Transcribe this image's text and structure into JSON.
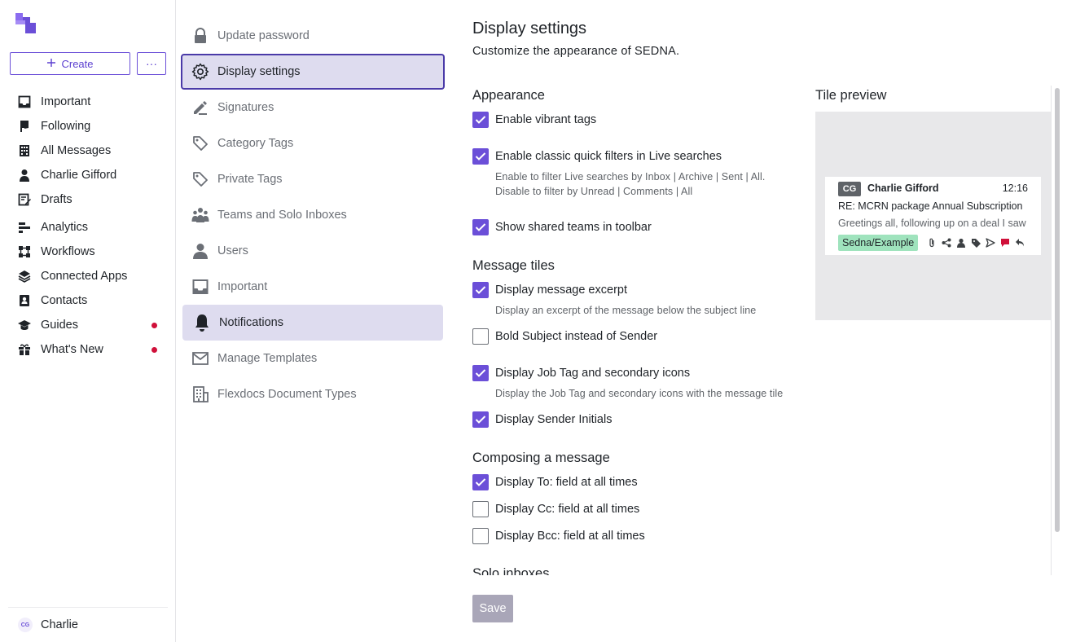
{
  "leftnav": {
    "create_label": "Create",
    "more_label": "···",
    "items": [
      {
        "label": "Important",
        "icon": "inbox-icon"
      },
      {
        "label": "Following",
        "icon": "flag-icon"
      },
      {
        "label": "All Messages",
        "icon": "building-icon"
      },
      {
        "label": "Charlie Gifford",
        "icon": "person-icon"
      },
      {
        "label": "Drafts",
        "icon": "drafts-icon"
      },
      {
        "label": "Analytics",
        "icon": "analytics-icon"
      },
      {
        "label": "Workflows",
        "icon": "workflow-icon"
      },
      {
        "label": "Connected Apps",
        "icon": "layers-icon"
      },
      {
        "label": "Contacts",
        "icon": "contacts-icon"
      },
      {
        "label": "Guides",
        "icon": "graduation-cap-icon",
        "dot": true
      },
      {
        "label": "What's New",
        "icon": "gift-icon",
        "dot": true
      }
    ],
    "user": {
      "initials": "CG",
      "name": "Charlie"
    }
  },
  "settings_menu": {
    "items": [
      {
        "label": "Update password",
        "icon": "lock-icon"
      },
      {
        "label": "Display settings",
        "icon": "gear-icon",
        "state": "selected"
      },
      {
        "label": "Signatures",
        "icon": "pen-icon"
      },
      {
        "label": "Category Tags",
        "icon": "tag-icon"
      },
      {
        "label": "Private Tags",
        "icon": "tag-icon"
      },
      {
        "label": "Teams and Solo Inboxes",
        "icon": "team-icon"
      },
      {
        "label": "Users",
        "icon": "user-icon"
      },
      {
        "label": "Important",
        "icon": "inbox-icon"
      },
      {
        "label": "Notifications",
        "icon": "bell-icon",
        "state": "hover"
      },
      {
        "label": "Manage Templates",
        "icon": "envelope-icon"
      },
      {
        "label": "Flexdocs Document Types",
        "icon": "building-icon"
      }
    ]
  },
  "page": {
    "title": "Display settings",
    "subtitle": "Customize the appearance of SEDNA.",
    "sections": {
      "appearance": "Appearance",
      "message_tiles": "Message tiles",
      "composing": "Composing a message",
      "solo": "Solo inboxes"
    },
    "options": {
      "vibrant_tags": {
        "label": "Enable vibrant tags",
        "checked": true
      },
      "classic_filters": {
        "label": "Enable classic quick filters in Live searches",
        "checked": true,
        "help1": "Enable to filter Live searches by Inbox | Archive | Sent | All.",
        "help2": "Disable to filter by Unread | Comments | All"
      },
      "shared_teams": {
        "label": "Show shared teams in toolbar",
        "checked": true
      },
      "excerpt": {
        "label": "Display message excerpt",
        "checked": true,
        "help": "Display an excerpt of the message below the subject line"
      },
      "bold_subject": {
        "label": "Bold Subject instead of Sender",
        "checked": false
      },
      "job_tag": {
        "label": "Display Job Tag and secondary icons",
        "checked": true,
        "help": "Display the Job Tag and secondary icons with the message tile"
      },
      "sender_initials": {
        "label": "Display Sender Initials",
        "checked": true
      },
      "to_field": {
        "label": "Display To: field at all times",
        "checked": true
      },
      "cc_field": {
        "label": "Display Cc: field at all times",
        "checked": false
      },
      "bcc_field": {
        "label": "Display Bcc: field at all times",
        "checked": false
      }
    },
    "save_label": "Save"
  },
  "tile_preview": {
    "title": "Tile preview",
    "initials": "CG",
    "sender": "Charlie Gifford",
    "time": "12:16",
    "subject": "RE: MCRN package Annual Subscription",
    "excerpt": "Greetings all, following up on a deal I saw",
    "tag": "Sedna/Example",
    "icons": [
      "paperclip-icon",
      "share-icon",
      "person-icon",
      "tag-icon",
      "send-icon",
      "comment-icon",
      "reply-icon"
    ],
    "tag_color": "#9fe3bd",
    "comment_color": "#d0103a"
  },
  "colors": {
    "accent": "#6b4fd8",
    "selected_bg": "#dedcef",
    "alert_dot": "#d0103a"
  }
}
